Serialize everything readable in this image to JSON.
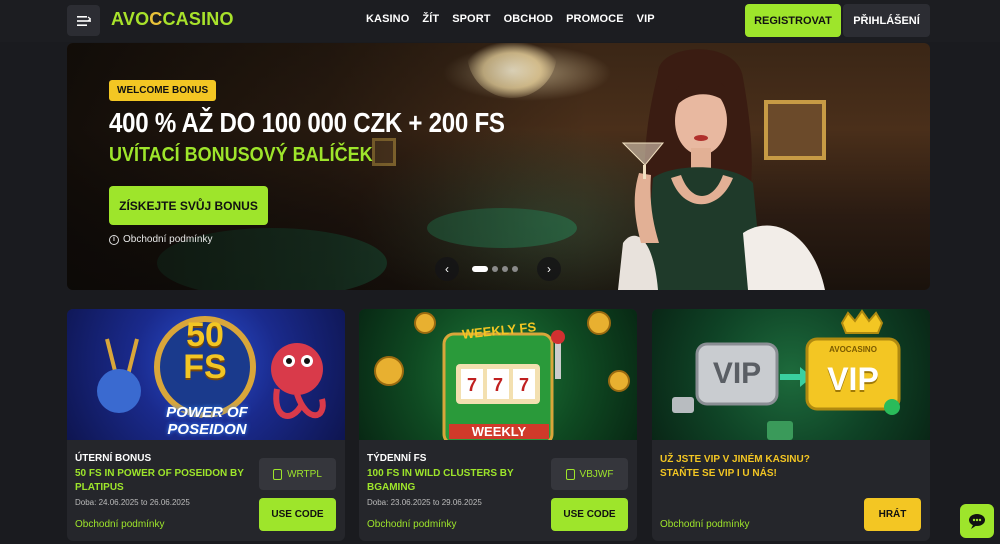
{
  "header": {
    "logo": {
      "left": "AVO",
      "mid": "C",
      "right": "CASINO"
    },
    "nav": [
      "KASINO",
      "ŽÍT",
      "SPORT",
      "OBCHOD",
      "PROMOCE",
      "VIP"
    ],
    "register_label": "REGISTROVAT",
    "login_label": "PŘIHLÁŠENÍ"
  },
  "hero": {
    "badge": "WELCOME BONUS",
    "title": "400 % AŽ DO 100 000 CZK + 200 FS",
    "subtitle": "UVÍTACÍ BONUSOVÝ BALÍČEK",
    "cta_label": "ZÍSKEJTE SVŮJ BONUS",
    "terms_label": "Obchodní podmínky",
    "slides_total": 4,
    "active_slide": 1
  },
  "cards": [
    {
      "art_title": "50\nFS",
      "art_sub": "POWER OF POSEIDON",
      "title": "ÚTERNÍ BONUS",
      "desc": "50 FS IN POWER OF POSEIDON BY PLATIPUS",
      "dates": "Doba: 24.06.2025 to 26.06.2025",
      "terms": "Obchodní podmínky",
      "code": "WRTPL",
      "button": "USE CODE"
    },
    {
      "art_title": "WEEKLY FS",
      "art_sub": "WEEKLY",
      "title": "TÝDENNÍ FS",
      "desc": "100 FS IN WILD CLUSTERS BY BGAMING",
      "dates": "Doba: 23.06.2025 to 29.06.2025",
      "terms": "Obchodní podmínky",
      "code": "VBJWF",
      "button": "USE CODE"
    },
    {
      "art_left": "VIP",
      "art_right": "VIP",
      "art_brand": "AVOCASINO",
      "title": "UŽ JSTE VIP V JINÉM KASINU? STAŇTE SE VIP I U NÁS!",
      "terms": "Obchodní podmínky",
      "button": "HRÁT"
    }
  ],
  "colors": {
    "accent": "#9ee52b",
    "gold": "#f3c623",
    "bg": "#1a1b1f"
  }
}
